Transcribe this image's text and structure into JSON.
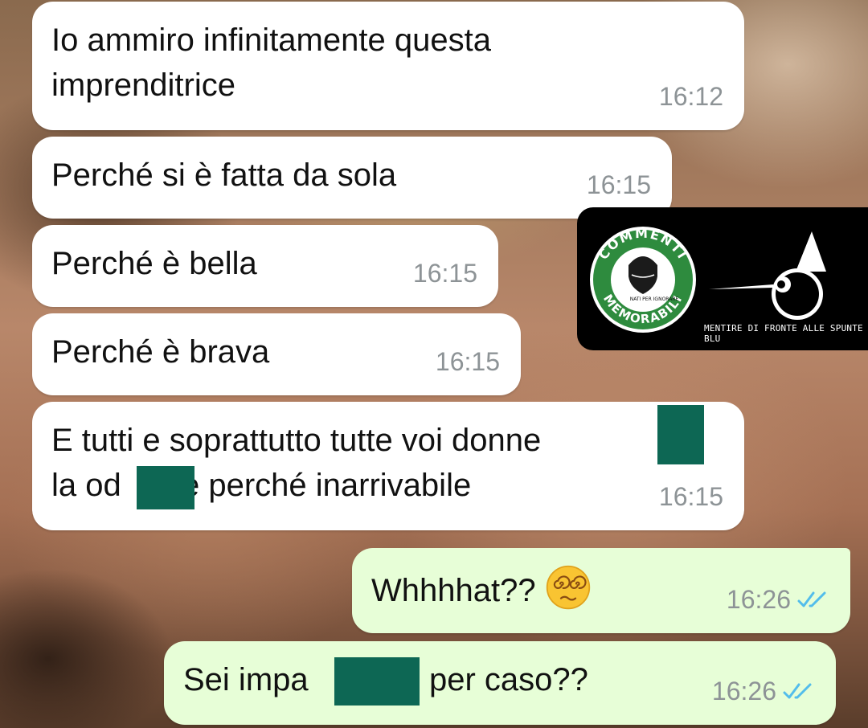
{
  "messages": [
    {
      "direction": "in",
      "lines": [
        "Io ammiro infinitamente questa",
        "imprenditrice"
      ],
      "time": "16:12"
    },
    {
      "direction": "in",
      "text": "Perché si è fatta da sola",
      "time": "16:15"
    },
    {
      "direction": "in",
      "text": "Perché è bella",
      "time": "16:15"
    },
    {
      "direction": "in",
      "text": "Perché è brava",
      "time": "16:15"
    },
    {
      "direction": "in",
      "line1": "E tutti e soprattutto tutte voi donne",
      "line2_a": "la od",
      "line2_b": "e perché inarrivabile",
      "time": "16:15"
    },
    {
      "direction": "out",
      "text": "Whhhhat??",
      "emoji": "face-with-spiral-eyes",
      "time": "16:26",
      "status": "read"
    },
    {
      "direction": "out",
      "text_a": "Sei impa",
      "text_b": "per caso??",
      "time": "16:26",
      "status": "read"
    }
  ],
  "watermark": {
    "logo_top_text": "COMMENTI",
    "logo_bottom_text": "MEMORABILI",
    "logo_small_text": "NATI PER IGNORARE",
    "caption": "MENTIRE DI FRONTE ALLE SPUNTE BLU",
    "icon": "pinocchio-icon"
  },
  "colors": {
    "incoming_bubble": "#ffffff",
    "outgoing_bubble": "#e7fed7",
    "read_ticks": "#53bdeb",
    "timestamp": "#8d9396",
    "redaction": "#0d6754",
    "logo_green": "#2e8b3e"
  }
}
